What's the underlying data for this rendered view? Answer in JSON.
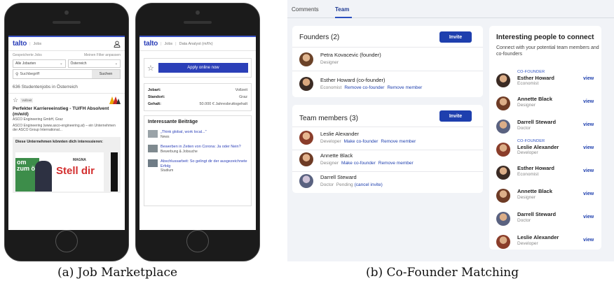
{
  "captions": {
    "a": "(a) Job Marketplace",
    "b": "(b) Co-Founder Matching"
  },
  "phone1": {
    "logo": "talto",
    "crumb": "Jobs",
    "saved_jobs": "Gespeicherte Jobs",
    "my_filters": "Meinen Filter anpassen",
    "select_type": "Alle Jobarten",
    "select_country": "Österreich",
    "search_placeholder": "Suchbegriff",
    "search_button": "Suchen",
    "result_count": "636 Studentenjobs in Österreich",
    "badge": "Vollzeit",
    "job_title": "Perfekter Karriereeinstieg - TU/FH Absolvent (m/w/d)",
    "company": "ASCO Engineering GmbH, Graz",
    "snippet": "ASCO Engineering (www.asco-engineering.at) – ein Unternehmen der ASCO Group International...",
    "companies_heading": "Diese Unternehmen könnten dich interessieren:",
    "ad_left": "om zum ör",
    "ad_brand": "MAGNA",
    "ad_slogan": "Stell dir"
  },
  "phone2": {
    "logo": "talto",
    "crumb1": "Jobs",
    "crumb2": "Data Analyst (m/f/x)",
    "apply_button": "Apply online now",
    "details": [
      {
        "label": "Jobart:",
        "value": "Vollzeit"
      },
      {
        "label": "Standort:",
        "value": "Graz"
      },
      {
        "label": "Gehalt:",
        "value": "50.000 € Jahresbruttogehalt"
      }
    ],
    "posts_heading": "Interessante Beiträge",
    "posts": [
      {
        "title": "„Think global, work local...\"",
        "category": "News"
      },
      {
        "title": "Bewerben in Zeiten von Corona: Ja oder Nein?",
        "category": "Bewerbung & Jobsuche"
      },
      {
        "title": "Abschlussarbeit: So gelingt dir der ausgezeichnete Erfolg",
        "category": "Studium"
      }
    ]
  },
  "app": {
    "tabs": [
      "Comments",
      "Team"
    ],
    "founders": {
      "title": "Founders (2)",
      "invite": "Invite",
      "members": [
        {
          "name": "Petra Kovacevic (founder)",
          "role": "Designer",
          "actions": []
        },
        {
          "name": "Esther Howard (co-founder)",
          "role": "Economist",
          "actions": [
            "Remove co-founder",
            "Remove member"
          ]
        }
      ]
    },
    "team": {
      "title": "Team members (3)",
      "invite": "Invite",
      "members": [
        {
          "name": "Leslie Alexander",
          "role": "Developer",
          "actions": [
            "Make co-founder",
            "Remove member"
          ]
        },
        {
          "name": "Annette Black",
          "role": "Designer",
          "actions": [
            "Make co-founder",
            "Remove member"
          ]
        },
        {
          "name": "Darrell Steward",
          "role": "Doctor",
          "status": "Pending",
          "actions": [
            "(cancel invite)"
          ]
        }
      ]
    },
    "suggestions": {
      "title": "Interesting people to connect",
      "subtitle": "Connect with your potential team members and co-founders",
      "view_label": "view",
      "people": [
        {
          "tag": "CO-FOUNDER",
          "name": "Esther Howard",
          "role": "Economist"
        },
        {
          "tag": "",
          "name": "Annette Black",
          "role": "Designer"
        },
        {
          "tag": "",
          "name": "Darrell Steward",
          "role": "Doctor"
        },
        {
          "tag": "CO-FOUNDER",
          "name": "Leslie Alexander",
          "role": "Developer"
        },
        {
          "tag": "",
          "name": "Esther Howard",
          "role": "Economist"
        },
        {
          "tag": "",
          "name": "Annette Black",
          "role": "Designer"
        },
        {
          "tag": "",
          "name": "Darrell Steward",
          "role": "Doctor"
        },
        {
          "tag": "",
          "name": "Leslie Alexander",
          "role": "Developer"
        }
      ]
    }
  }
}
